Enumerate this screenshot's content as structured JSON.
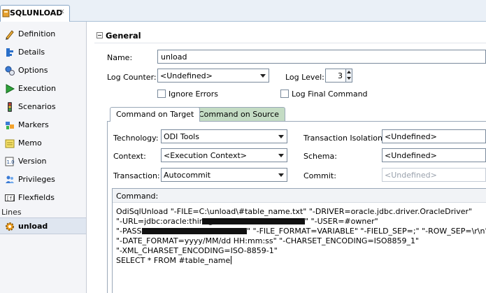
{
  "tab": {
    "title": "SQLUNLOAD",
    "close": "x"
  },
  "nav": {
    "items": [
      {
        "label": "Definition"
      },
      {
        "label": "Details"
      },
      {
        "label": "Options"
      },
      {
        "label": "Execution"
      },
      {
        "label": "Scenarios"
      },
      {
        "label": "Markers"
      },
      {
        "label": "Memo"
      },
      {
        "label": "Version"
      },
      {
        "label": "Privileges"
      },
      {
        "label": "Flexfields"
      }
    ],
    "lines_label": "Lines",
    "line_item": "unload"
  },
  "general": {
    "title": "General",
    "name_label": "Name:",
    "name_value": "unload",
    "log_counter_label": "Log Counter:",
    "log_counter_value": "<Undefined>",
    "log_level_label": "Log Level:",
    "log_level_value": "3",
    "ignore_errors_label": "Ignore Errors",
    "log_final_label": "Log Final Command"
  },
  "tabs": [
    {
      "label": "Command on Target"
    },
    {
      "label": "Command on Source"
    }
  ],
  "target": {
    "technology_label": "Technology:",
    "technology_value": "ODI Tools",
    "context_label": "Context:",
    "context_value": "<Execution Context>",
    "transaction_label": "Transaction:",
    "transaction_value": "Autocommit",
    "isolation_label": "Transaction Isolation:",
    "isolation_value": "<Undefined>",
    "schema_label": "Schema:",
    "schema_value": "<Undefined>",
    "commit_label": "Commit:",
    "commit_value": "<Undefined>"
  },
  "command": {
    "label": "Command:",
    "lines": [
      "OdiSqlUnload \"-FILE=C:\\unload\\#table_name.txt\" \"-DRIVER=oracle.jdbc.driver.OracleDriver\"",
      "\"-URL=jdbc:oracle:thin:@",
      "\" \"-USER=#owner\"",
      "\"-PASS=",
      "\" \"-FILE_FORMAT=VARIABLE\" \"-FIELD_SEP=;\" \"-ROW_SEP=\\r\\n\"",
      "\"-DATE_FORMAT=yyyy/MM/dd HH:mm:ss\" \"-CHARSET_ENCODING=ISO8859_1\"",
      "\"-XML_CHARSET_ENCODING=ISO-8859-1\"",
      "SELECT * FROM #table_name"
    ]
  },
  "colors": {
    "tab_strip": "#eaf0f7",
    "inactive_tab": "#c4dcc4",
    "nav_background": "#f4f5f8",
    "selected_line": "#dfe6f0"
  }
}
